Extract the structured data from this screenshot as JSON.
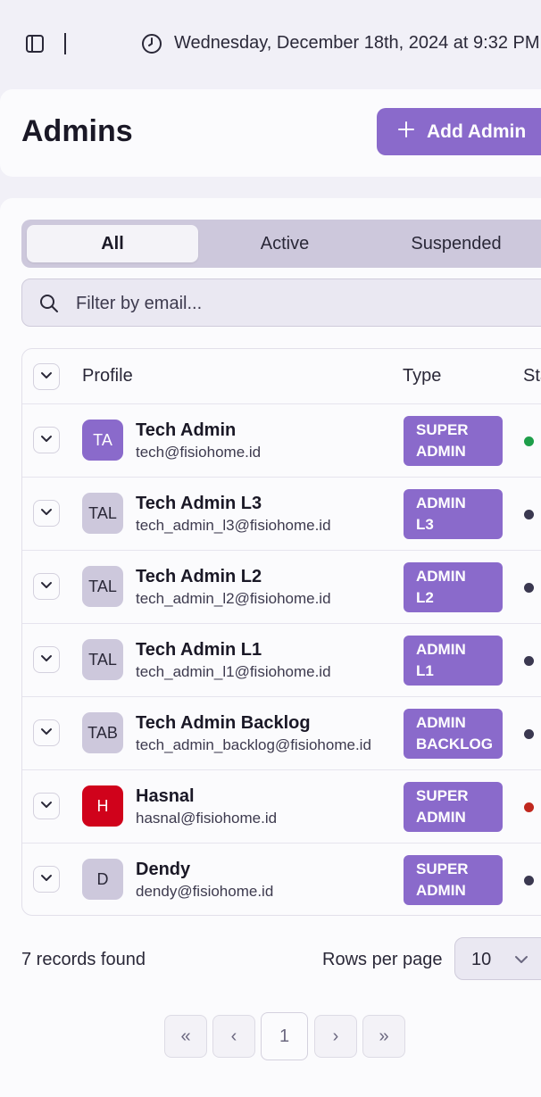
{
  "topbar": {
    "datetime": "Wednesday, December 18th, 2024 at 9:32 PM"
  },
  "header": {
    "title": "Admins",
    "add_button_label": "Add Admin"
  },
  "tabs": [
    {
      "label": "All",
      "active": true
    },
    {
      "label": "Active",
      "active": false
    },
    {
      "label": "Suspended",
      "active": false
    }
  ],
  "filter": {
    "placeholder": "Filter by email..."
  },
  "table": {
    "columns": {
      "profile": "Profile",
      "type": "Type",
      "status": "Status"
    },
    "rows": [
      {
        "initials": "TA",
        "name": "Tech Admin",
        "email": "tech@fisiohome.id",
        "type": "SUPER\nADMIN",
        "avatar_bg": "#8a6acb",
        "avatar_fg": "#ffffff",
        "status_color": "#1e9e4a"
      },
      {
        "initials": "TAL",
        "name": "Tech Admin L3",
        "email": "tech_admin_l3@fisiohome.id",
        "type": "ADMIN\nL3",
        "avatar_bg": "#cdc8dc",
        "avatar_fg": "#2a2838",
        "status_color": "#3a3850"
      },
      {
        "initials": "TAL",
        "name": "Tech Admin L2",
        "email": "tech_admin_l2@fisiohome.id",
        "type": "ADMIN\nL2",
        "avatar_bg": "#cdc8dc",
        "avatar_fg": "#2a2838",
        "status_color": "#3a3850"
      },
      {
        "initials": "TAL",
        "name": "Tech Admin L1",
        "email": "tech_admin_l1@fisiohome.id",
        "type": "ADMIN\nL1",
        "avatar_bg": "#cdc8dc",
        "avatar_fg": "#2a2838",
        "status_color": "#3a3850"
      },
      {
        "initials": "TAB",
        "name": "Tech Admin Backlog",
        "email": "tech_admin_backlog@fisiohome.id",
        "type": "ADMIN\nBACKLOG",
        "avatar_bg": "#cdc8dc",
        "avatar_fg": "#2a2838",
        "status_color": "#3a3850"
      },
      {
        "initials": "H",
        "name": "Hasnal",
        "email": "hasnal@fisiohome.id",
        "type": "SUPER\nADMIN",
        "avatar_bg": "#d0021b",
        "avatar_fg": "#ffffff",
        "status_color": "#c0281e"
      },
      {
        "initials": "D",
        "name": "Dendy",
        "email": "dendy@fisiohome.id",
        "type": "SUPER\nADMIN",
        "avatar_bg": "#cdc8dc",
        "avatar_fg": "#2a2838",
        "status_color": "#3a3850"
      }
    ]
  },
  "footer": {
    "records_found": "7 records found",
    "rows_per_page_label": "Rows per page",
    "rows_per_page_value": "10"
  },
  "pagination": {
    "first": "«",
    "prev": "‹",
    "current_page": "1",
    "next": "›",
    "last": "»"
  },
  "colors": {
    "accent": "#8a6acb",
    "background": "#f1f0f7",
    "surface": "#fbfbfd"
  }
}
